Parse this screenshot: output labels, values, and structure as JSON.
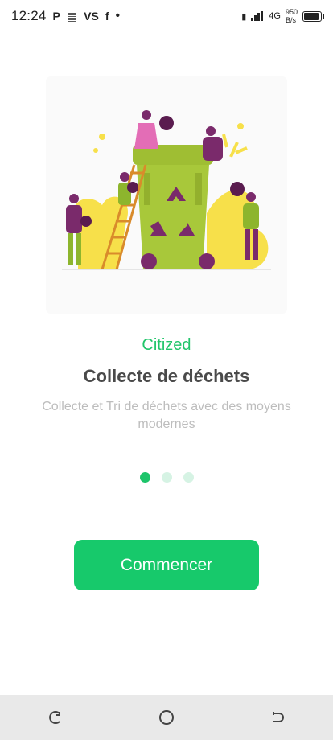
{
  "status_bar": {
    "time": "12:24",
    "icons": [
      "P",
      "news-icon",
      "VS",
      "facebook-icon",
      "dot"
    ],
    "network": "4G",
    "speed_value": "950",
    "speed_unit": "B/s"
  },
  "onboarding": {
    "brand": "Citized",
    "title": "Collecte de déchets",
    "subtitle": "Collecte et Tri de déchets avec des moyens modernes",
    "page_index": 0,
    "page_count": 3,
    "cta_label": "Commencer"
  },
  "colors": {
    "accent": "#17c96b",
    "dot_inactive": "#d6f3e4",
    "bin": "#a8c83a",
    "purple": "#7a2a6b",
    "yellow": "#f7e04a"
  },
  "nav": {
    "back": "back-icon",
    "home": "home-icon",
    "recents": "recents-icon"
  }
}
